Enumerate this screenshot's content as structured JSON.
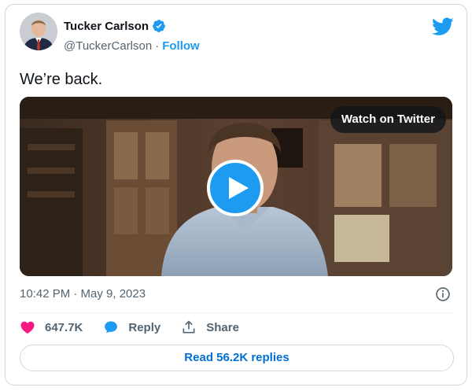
{
  "author": {
    "name": "Tucker Carlson",
    "handle": "@TuckerCarlson",
    "separator": "·",
    "follow_label": "Follow",
    "verified_icon": "verified-badge-icon"
  },
  "tweet": {
    "text": "We’re back.",
    "timestamp": "10:42 PM · May 9, 2023"
  },
  "media": {
    "watch_label": "Watch on Twitter",
    "play_icon": "play-icon"
  },
  "actions": {
    "likes_count": "647.7K",
    "reply_label": "Reply",
    "share_label": "Share"
  },
  "replies_button": {
    "label": "Read 56.2K replies"
  },
  "colors": {
    "accent": "#1d9bf0",
    "like": "#f91880",
    "link_dark": "#006fd6",
    "secondary_text": "#536471",
    "border": "#cfd9de"
  }
}
